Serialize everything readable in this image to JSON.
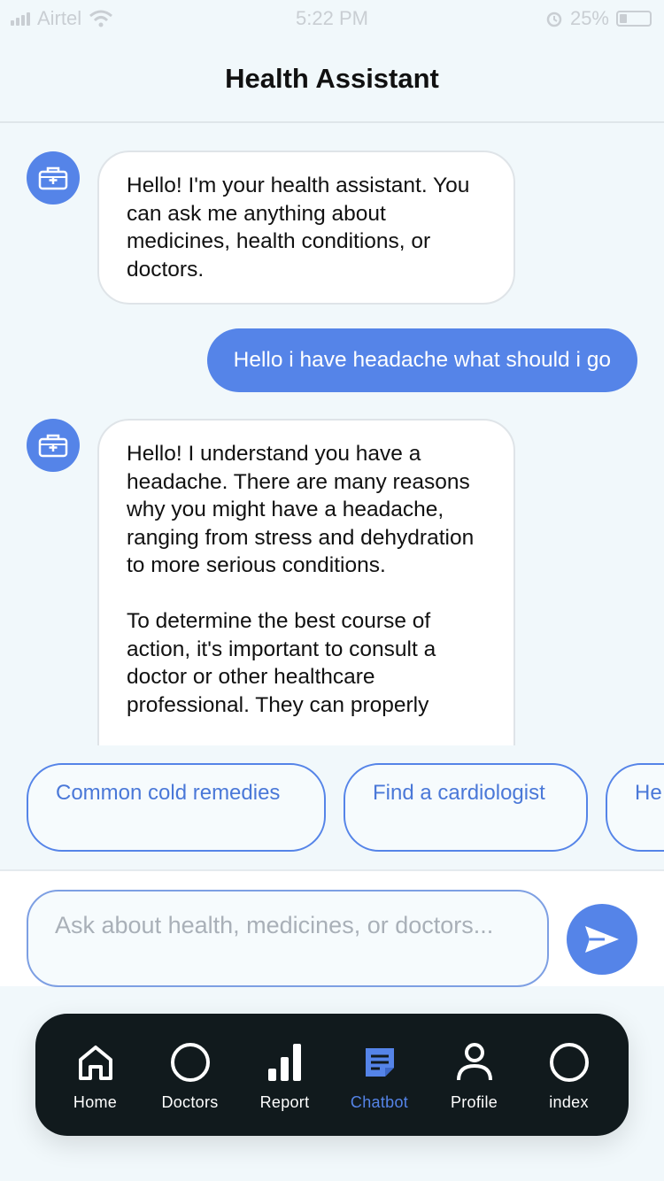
{
  "status_bar": {
    "carrier": "Airtel",
    "time": "5:22 PM",
    "battery": "25%"
  },
  "header": {
    "title": "Health Assistant"
  },
  "messages": [
    {
      "sender": "bot",
      "text": "Hello! I'm your health assistant. You can ask me anything about medicines, health conditions, or doctors."
    },
    {
      "sender": "user",
      "text": "Hello i have headache what should i go"
    },
    {
      "sender": "bot",
      "text": "Hello!  I understand you have a headache.  There are many reasons why you might have a headache, ranging from stress and dehydration to more serious conditions.\n\nTo determine the best course of action, it's important to consult a doctor or other healthcare professional. They can properly"
    }
  ],
  "suggestions": [
    "Common cold remedies",
    "Find a cardiologist",
    "He"
  ],
  "input": {
    "placeholder": "Ask about health, medicines, or doctors..."
  },
  "tabs": [
    {
      "label": "Home",
      "icon": "home-icon",
      "active": false
    },
    {
      "label": "Doctors",
      "icon": "circle-icon",
      "active": false
    },
    {
      "label": "Report",
      "icon": "bar-chart-icon",
      "active": false
    },
    {
      "label": "Chatbot",
      "icon": "chat-note-icon",
      "active": true
    },
    {
      "label": "Profile",
      "icon": "person-icon",
      "active": false
    },
    {
      "label": "index",
      "icon": "circle-icon",
      "active": false
    }
  ],
  "colors": {
    "accent": "#5584e8",
    "tabbar": "#111a1d",
    "background": "#f1f8fb"
  }
}
